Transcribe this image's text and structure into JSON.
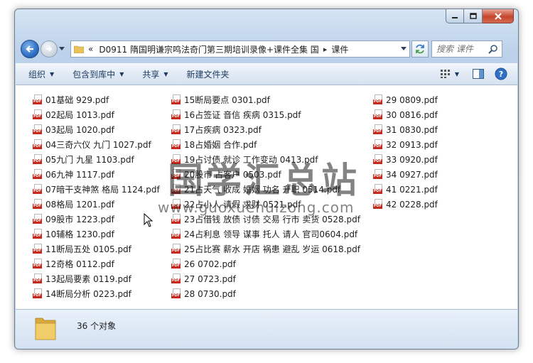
{
  "address": {
    "crumb_overflow": "«",
    "crumbs": [
      "D0911 隋国明谦宗鸣法奇门第三期培训录像+课件全集 国",
      "课件"
    ],
    "separator": "▸"
  },
  "search": {
    "placeholder": "搜索 课件"
  },
  "toolbar": {
    "organize": "组织",
    "include_library": "包含到库中",
    "share": "共享",
    "new_folder": "新建文件夹"
  },
  "files": {
    "col1": [
      "01基础 929.pdf",
      "02起局 1013.pdf",
      "03起局 1020.pdf",
      "04三奇六仪 九门 1027.pdf",
      "05九门 九星 1103.pdf",
      "06九神 1117.pdf",
      "07暗干支神煞 格局 1124.pdf",
      "08格局 1201.pdf",
      "09股市 1223.pdf",
      "10辅格 1230.pdf",
      "11断局五处 0105.pdf",
      "12奇格 0112.pdf",
      "13起局要素 0119.pdf",
      "14断局分析 0223.pdf"
    ],
    "col2": [
      "15断局要点 0301.pdf",
      "16占签证 音信 疾病 0315.pdf",
      "17占疾病 0323.pdf",
      "18占婚姻 合作.pdf",
      "19占讨债 就诊 工作变动 0413.pdf",
      "20股市 占客户 0503.pdf",
      "21占天气 收成 婚姻 功名 升职 0514.pdf",
      "22占小人 请假 求财 0521.pdf",
      "23占借钱 放债 讨债 交易 行市 卖货 0528.pdf",
      "24占利息 领导 谋事 托人 请人 官司0604.pdf",
      "25占比赛 薪水 开店 祸患 避乱 岁运 0618.pdf",
      "26 0702.pdf",
      "27 0723.pdf",
      "28 0730.pdf"
    ],
    "col3": [
      "29 0809.pdf",
      "30 0816.pdf",
      "31 0830.pdf",
      "32 0913.pdf",
      "33 0920.pdf",
      "34 0927.pdf",
      "41 0221.pdf",
      "42 0228.pdf"
    ]
  },
  "icons": {
    "pdf_tag": "PDF"
  },
  "watermark": {
    "text": "国学汇总站",
    "url": "www.guoxuehuizong.com"
  },
  "status": {
    "count": "36 个对象"
  },
  "colors": {
    "pdf_red": "#c52a1d",
    "folder_yellow": "#e8c25a",
    "close_red": "#c5462b"
  }
}
